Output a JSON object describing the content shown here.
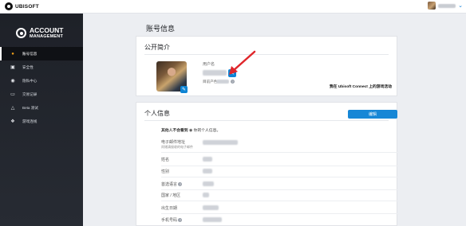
{
  "topbar": {
    "brand": "UBISOFT",
    "dropdown_icon": "chevron-down-icon"
  },
  "sidebar": {
    "logo_line1": "ACCOUNT",
    "logo_line2": "MANAGEMENT",
    "items": [
      {
        "label": "账号信息",
        "icon": "user-icon",
        "active": true
      },
      {
        "label": "安全性",
        "icon": "lock-icon"
      },
      {
        "label": "隐私中心",
        "icon": "eye-icon"
      },
      {
        "label": "交易记录",
        "icon": "card-icon"
      },
      {
        "label": "Beta 测试",
        "icon": "flask-icon"
      },
      {
        "label": "游戏连线",
        "icon": "gamepad-icon"
      }
    ]
  },
  "main": {
    "page_title": "账号信息",
    "public_profile": {
      "title": "公开简介",
      "username_label": "用户名",
      "region_label": "目前产色",
      "connect_link": "我在 Ubisoft Connect 上的游戏活动"
    },
    "personal_info": {
      "title": "个人信息",
      "edit_label": "编辑",
      "privacy_prefix": "其他人不会看到",
      "privacy_suffix": "你的个人信息。",
      "fields": [
        {
          "label": "电子邮件地址",
          "sub": "尚储清接收的电子邮件"
        },
        {
          "label": "姓名"
        },
        {
          "label": "性别"
        },
        {
          "label": "首选语言",
          "help": true
        },
        {
          "label": "国家 / 地区"
        },
        {
          "label": "出生日期"
        },
        {
          "label": "手机号码",
          "help": true
        }
      ]
    }
  },
  "colors": {
    "accent": "#1787d6",
    "sidebar_bg": "#1e2128",
    "arrow": "#e0262b",
    "page_bg": "#eceef2"
  }
}
